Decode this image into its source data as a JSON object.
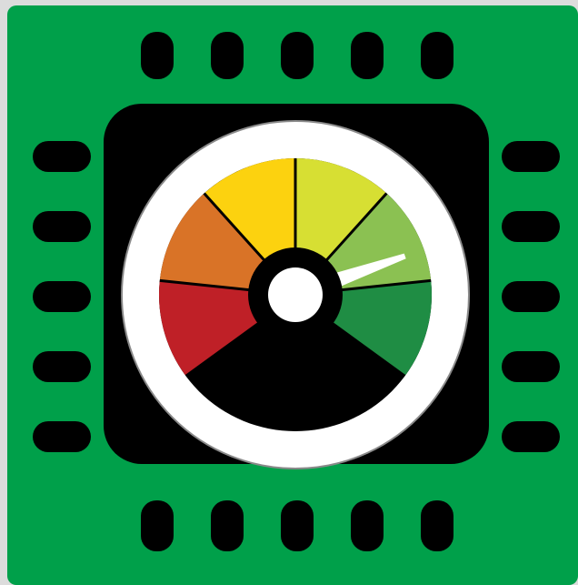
{
  "icon": {
    "name": "cpu-performance-gauge",
    "colors": {
      "page_background": "#dcdcdc",
      "board": "#00a04a",
      "chip": "#000000",
      "pins": "#000000",
      "dial_ring": "#ffffff",
      "dial_ring_outline": "#8a8a8a",
      "needle": "#ffffff",
      "hub": "#ffffff",
      "hub_ring": "#000000",
      "divider_lines": "#000000"
    },
    "gauge": {
      "segments": [
        {
          "id": "red",
          "color": "#bf2027"
        },
        {
          "id": "orange",
          "color": "#d97327"
        },
        {
          "id": "yellow",
          "color": "#fcd20f"
        },
        {
          "id": "yellow-green",
          "color": "#d7df33"
        },
        {
          "id": "light-green",
          "color": "#8bc152"
        },
        {
          "id": "green",
          "color": "#1f8d44"
        }
      ],
      "needle_level_percent": 78
    },
    "pins": {
      "top_count": 5,
      "bottom_count": 5,
      "left_count": 5,
      "right_count": 5
    }
  }
}
